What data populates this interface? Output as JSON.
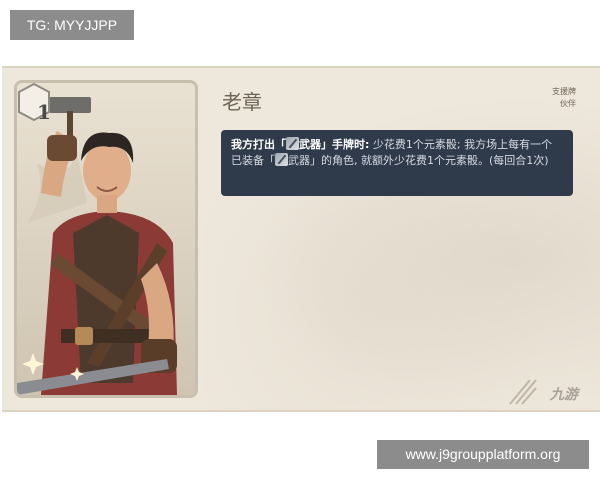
{
  "watermark": {
    "text": "TG: MYYJJPP"
  },
  "footer": {
    "url": "www.j9groupplatform.org"
  },
  "card": {
    "cost": "1",
    "name": "老章",
    "type_line1": "支援牌",
    "type_line2": "伙伴"
  },
  "description": {
    "trigger_prefix": "我方打出「",
    "trigger_tag": "武器",
    "trigger_suffix": "」手牌时:",
    "text_part1": " 少花费1个元素骰; 我方场上每有一个已装备「",
    "text_tag": "武器",
    "text_part2": "」的角色, 就额外少花费1个元素骰。(每回合1次)"
  },
  "logo": {
    "text": "九游"
  },
  "colors": {
    "panel_bg": "#eee7db",
    "desc_bg": "#2f3a4b",
    "name_color": "#6e6456"
  }
}
